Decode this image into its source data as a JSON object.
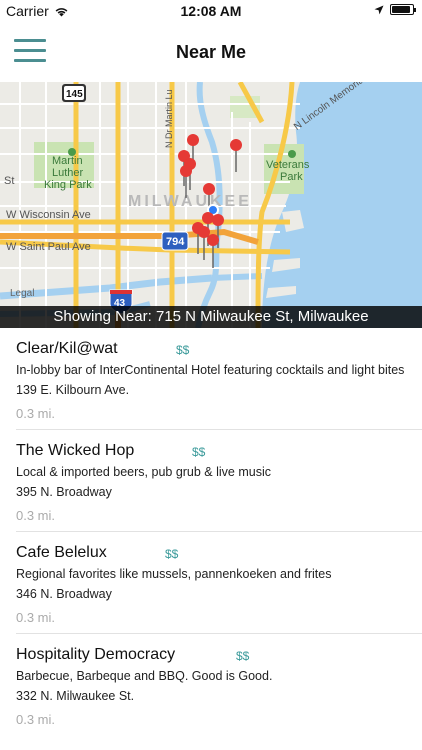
{
  "status_bar": {
    "carrier": "Carrier",
    "time": "12:08 AM",
    "battery_level": 0.9
  },
  "nav": {
    "title": "Near Me",
    "menu_icon": "hamburger-menu-icon"
  },
  "map": {
    "labels": {
      "city": "MILWAUKEE",
      "park1": "Martin Luther King Park",
      "park2": "Veterans Park",
      "street1": "W Wisconsin Ave",
      "street2": "W Saint Paul Ave",
      "street3": "St",
      "street4": "N Lincoln Memorial Dr",
      "street5": "N Dr Martin Lu",
      "legal": "Legal",
      "shield145": "145",
      "shield794": "794",
      "shield43": "43"
    },
    "colors": {
      "water": "#a5d0f0",
      "road": "#f7c948",
      "land": "#ecebe6",
      "park": "#c9e3b2",
      "pin": "#e53935"
    }
  },
  "showing_near": "Showing Near: 715 N Milwaukee St, Milwaukee",
  "places": [
    {
      "name": "Clear/Kil@wat",
      "price": "$$",
      "description": "In-lobby bar of InterContinental Hotel featuring cocktails and light bites",
      "address": "139 E. Kilbourn Ave.",
      "distance": "0.3 mi."
    },
    {
      "name": "The Wicked Hop",
      "price": "$$",
      "description": "Local & imported beers, pub grub & live music",
      "address": "395 N. Broadway",
      "distance": "0.3 mi."
    },
    {
      "name": "Cafe Belelux",
      "price": "$$",
      "description": "Regional favorites like mussels, pannenkoeken and frites",
      "address": "346 N. Broadway",
      "distance": "0.3 mi."
    },
    {
      "name": "Hospitality Democracy",
      "price": "$$",
      "description": "Barbecue, Barbeque and BBQ. Good is Good.",
      "address": "332 N. Milwaukee St.",
      "distance": "0.3 mi."
    }
  ]
}
